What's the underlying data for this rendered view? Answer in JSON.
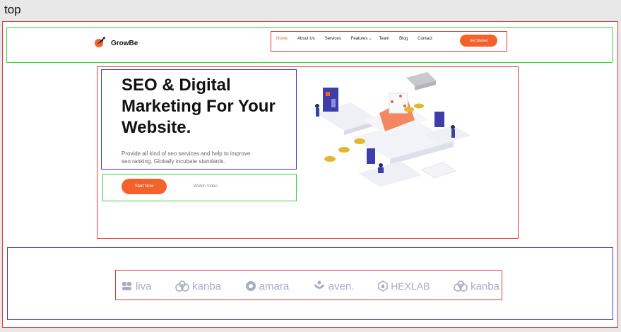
{
  "labels": {
    "top": "top",
    "top_header": "top-header",
    "top_header_menu": "top-header-menu",
    "top_content": "top-content",
    "top_content_text": "top-content-text",
    "top_content_btn": "top-content-btn",
    "top_footer": "top-footer",
    "top_footer_logo": "top-footer-logo"
  },
  "header": {
    "brand": "GrowBe",
    "nav": [
      "Home",
      "About Us",
      "Services",
      "Features",
      "Team",
      "Blog",
      "Contact"
    ],
    "features_caret": "⌄",
    "cta": "Get Started"
  },
  "hero": {
    "title_lines": [
      "SEO & Digital",
      "Marketing For Your",
      "Website."
    ],
    "subtitle_lines": [
      "Provide all kind of seo services and help to improve",
      "seo ranking. Globally incubate standards."
    ],
    "primary_btn": "Start Now",
    "secondary_btn": "Watch Video"
  },
  "footer": {
    "partners": [
      "liva",
      "kanba",
      "amara",
      "aven.",
      "HEXLAB",
      "kanba"
    ]
  },
  "colors": {
    "accent": "#f4622c",
    "frame_red": "#e23a3a",
    "frame_green": "#3bd43b",
    "frame_blue": "#3e3ed6"
  }
}
